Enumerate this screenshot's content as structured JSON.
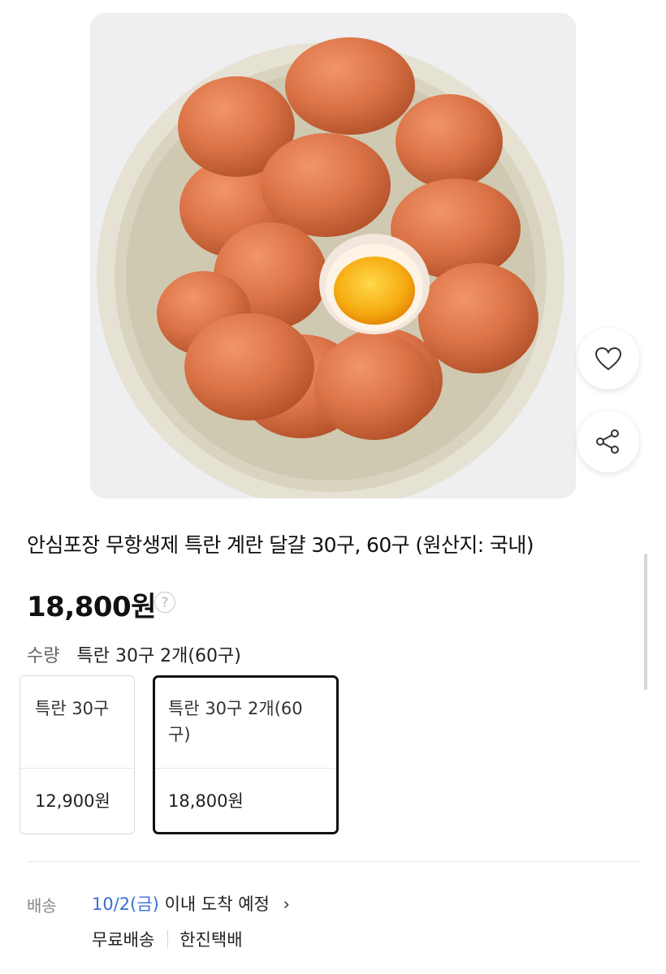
{
  "product": {
    "title": "안심포장 무항생제 특란 계란 달걀 30구, 60구 (원산지: 국내)",
    "price": "18,800원",
    "price_help_icon": "?"
  },
  "quantity": {
    "label": "수량",
    "selected": "특란 30구 2개(60구)"
  },
  "options": [
    {
      "name": "특란 30구",
      "price": "12,900원",
      "selected": false
    },
    {
      "name": "특란 30구 2개(60구)",
      "price": "18,800원",
      "selected": true
    }
  ],
  "shipping": {
    "label": "배송",
    "date": "10/2(금)",
    "eta_text": "이내 도착 예정",
    "chevron": "›",
    "fee": "무료배송",
    "carrier": "한진택배"
  },
  "icons": {
    "like": "heart-icon",
    "share": "share-icon"
  },
  "colors": {
    "accent_blue": "#3a6fd8",
    "selected_border": "#111111",
    "egg": "#d9734a",
    "yolk": "#f5a90e"
  }
}
